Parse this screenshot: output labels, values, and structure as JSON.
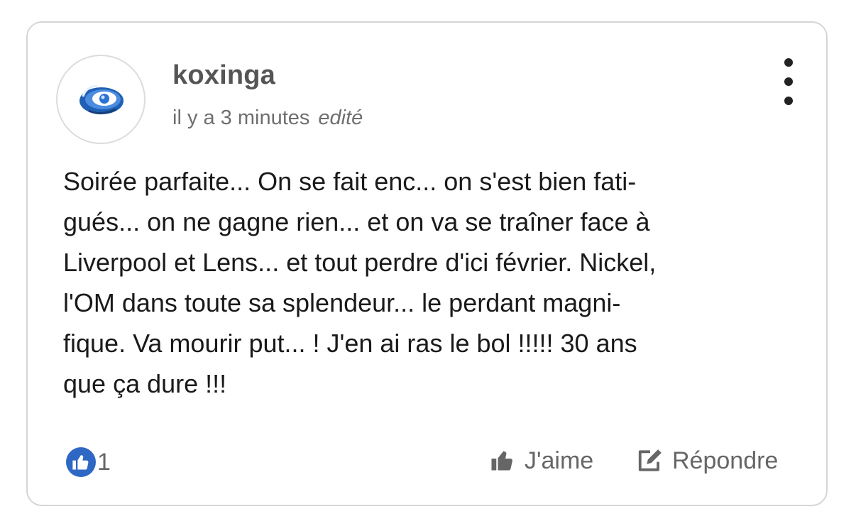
{
  "comment": {
    "author": "koxinga",
    "time": "il y a 3 minutes",
    "edited": "edité",
    "lines": [
      "Soirée parfaite... On se fait enc... on s'est bien fati-",
      "gués... on ne gagne rien... et on va se traîner face à",
      "Liverpool et Lens... et tout perdre d'ici février. Nickel,",
      "l'OM dans toute sa splendeur... le perdant magni-",
      "fique. Va mourir put... ! J'en ai ras le bol !!!!! 30 ans",
      "que ça dure !!!"
    ],
    "like_count": "1"
  },
  "actions": {
    "like_label": "J'aime",
    "reply_label": "Répondre"
  },
  "icons": {
    "avatar": "blue-eye-logo",
    "menu": "more-vertical-icon",
    "likes_badge": "thumbs-up-icon",
    "like_action": "thumbs-up-icon",
    "reply_action": "edit-icon"
  },
  "colors": {
    "like_badge": "#2f67c4",
    "author": "#555555",
    "muted_text": "#666666",
    "border": "#d5d5d5"
  }
}
